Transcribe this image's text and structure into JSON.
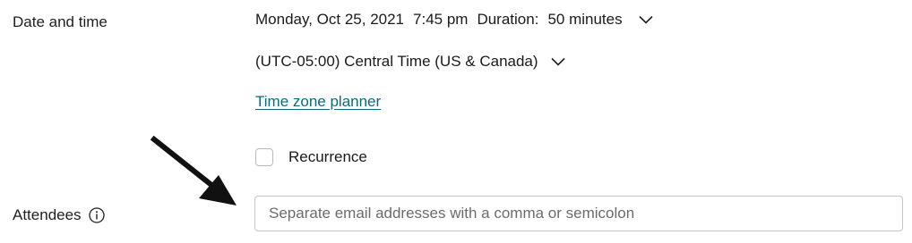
{
  "labels": {
    "date_and_time": "Date and time",
    "attendees": "Attendees"
  },
  "datetime": {
    "date": "Monday, Oct 25, 2021",
    "time": "7:45 pm",
    "duration_label": "Duration:",
    "duration_value": "50 minutes"
  },
  "timezone": {
    "value": "(UTC-05:00) Central Time (US & Canada)"
  },
  "links": {
    "time_zone_planner": "Time zone planner"
  },
  "recurrence": {
    "label": "Recurrence",
    "checked": false
  },
  "attendees": {
    "placeholder": "Separate email addresses with a comma or semicolon",
    "value": ""
  },
  "icons": {
    "info": "info-icon",
    "dropdown": "chevron-down-icon",
    "annotation": "arrow-icon"
  },
  "colors": {
    "link": "#0b6b7e",
    "text": "#1a1a1a",
    "border": "#c6c6c6"
  }
}
